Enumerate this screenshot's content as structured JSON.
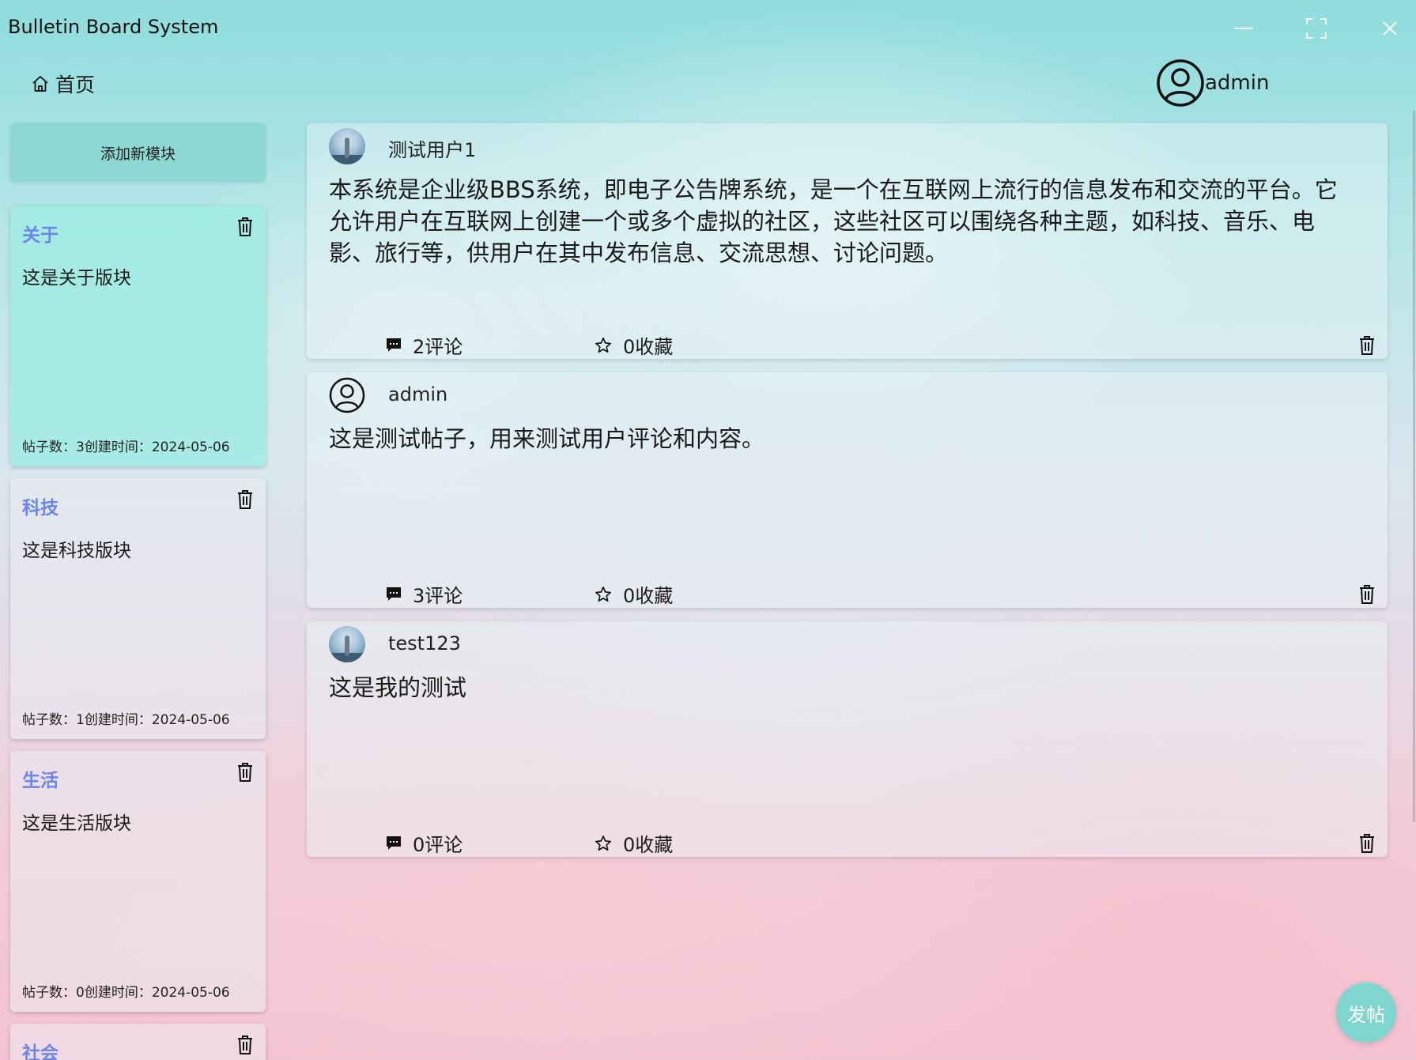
{
  "window": {
    "title": "Bulletin Board System"
  },
  "nav": {
    "home_label": "首页",
    "user_name": "admin"
  },
  "sidebar": {
    "add_module_label": "添加新模块",
    "modules": [
      {
        "name": "关于",
        "description": "这是关于版块",
        "meta": "帖子数：3创建时间：2024-05-06",
        "active": true
      },
      {
        "name": "科技",
        "description": "这是科技版块",
        "meta": "帖子数：1创建时间：2024-05-06",
        "active": false
      },
      {
        "name": "生活",
        "description": "这是生活版块",
        "meta": "帖子数：0创建时间：2024-05-06",
        "active": false
      },
      {
        "name": "社会",
        "description": "",
        "meta": "",
        "active": false
      }
    ]
  },
  "posts": [
    {
      "author": "测试用户1",
      "avatar": "photo",
      "content": "本系统是企业级BBS系统，即电子公告牌系统，是一个在互联网上流行的信息发布和交流的平台。它允许用户在互联网上创建一个或多个虚拟的社区，这些社区可以围绕各种主题，如科技、音乐、电影、旅行等，供用户在其中发布信息、交流思想、讨论问题。",
      "comments": "2评论",
      "favorites": "0收藏"
    },
    {
      "author": "admin",
      "avatar": "user-outline-icon",
      "content": "这是测试帖子，用来测试用户评论和内容。",
      "comments": "3评论",
      "favorites": "0收藏"
    },
    {
      "author": "test123",
      "avatar": "photo",
      "content": "这是我的测试",
      "comments": "0评论",
      "favorites": "0收藏"
    }
  ],
  "publish_label": "发帖",
  "colors": {
    "accent": "#8dd8d2",
    "module_title": "#6b86e8",
    "active_module_bg": "#a0ebe4"
  }
}
